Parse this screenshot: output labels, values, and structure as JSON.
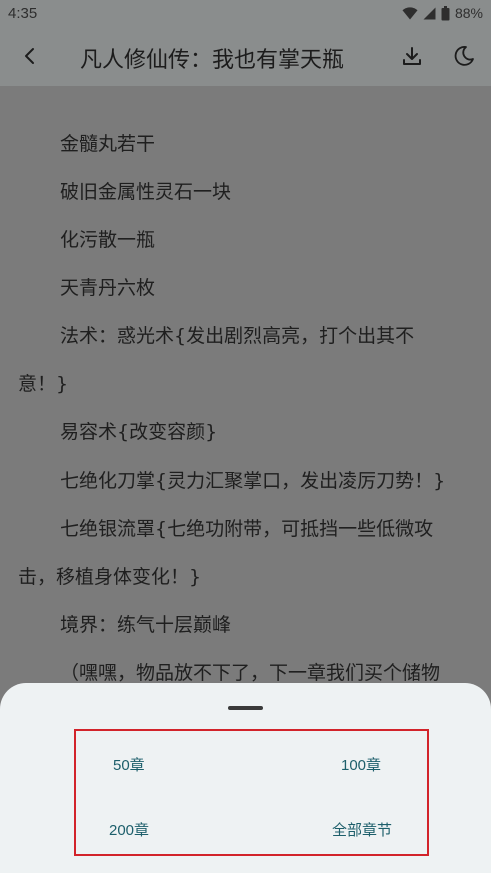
{
  "status_bar": {
    "time": "4:35",
    "battery": "88%",
    "icons": [
      "wifi-icon",
      "cellular-signal-icon",
      "battery-icon"
    ]
  },
  "toolbar": {
    "title": "凡人修仙传：我也有掌天瓶",
    "icons": [
      "back-arrow-icon",
      "download-icon",
      "night-mode-moon-icon"
    ]
  },
  "content": {
    "lines": [
      "金髓丸若干",
      "破旧金属性灵石一块",
      "化污散一瓶",
      "天青丹六枚",
      "法术：惑光术{发出剧烈高亮，打个出其不",
      "意！}",
      "易容术{改变容颜}",
      "七绝化刀掌{灵力汇聚掌口，发出凌厉刀势！}",
      "七绝银流罩{七绝功附带，可抵挡一些低微攻",
      "击，移植身体变化！}",
      "境界：练气十层巅峰",
      "（嘿嘿，物品放不下了，下一章我们买个储物"
    ]
  },
  "download_sheet": {
    "options": [
      "50章",
      "100章",
      "200章",
      "全部章节"
    ]
  },
  "colors": {
    "overlay_bg": "#7b7b7b",
    "sheet_bg": "#eef2f3",
    "option_text": "#1d5f6b",
    "highlight_border": "#d2232a"
  }
}
